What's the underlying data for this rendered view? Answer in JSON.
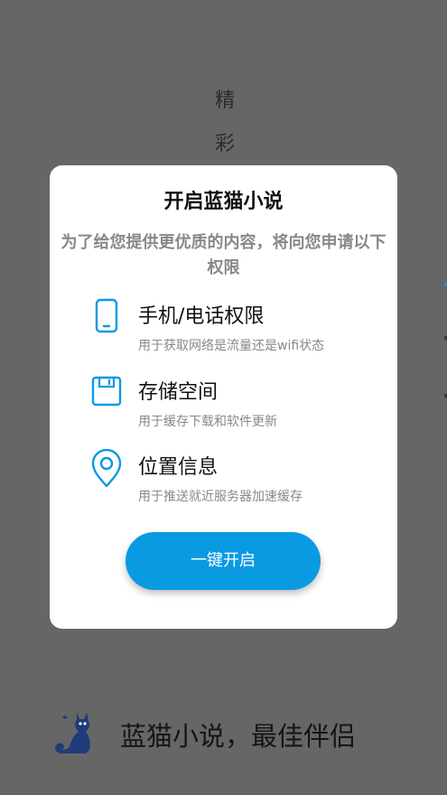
{
  "background": {
    "vertical_title": [
      "精",
      "彩"
    ]
  },
  "dialog": {
    "title": "开启蓝猫小说",
    "subtitle_line1": "为了给您提供更优质的内容，将向您申请以下",
    "subtitle_line2": "权限",
    "permissions": [
      {
        "icon": "phone-icon",
        "name": "手机/电话权限",
        "desc": "用于获取网络是流量还是wifi状态"
      },
      {
        "icon": "storage-icon",
        "name": "存储空间",
        "desc": "用于缓存下载和软件更新"
      },
      {
        "icon": "location-pin-icon",
        "name": "位置信息",
        "desc": "用于推送就近服务器加速缓存"
      }
    ],
    "button_label": "一键开启"
  },
  "footer": {
    "logo_icon": "cat-logo-icon",
    "slogan": "蓝猫小说，最佳伴侣"
  },
  "colors": {
    "accent": "#0A9AE2",
    "overlay": "#666666",
    "logo": "#1F3C78"
  }
}
